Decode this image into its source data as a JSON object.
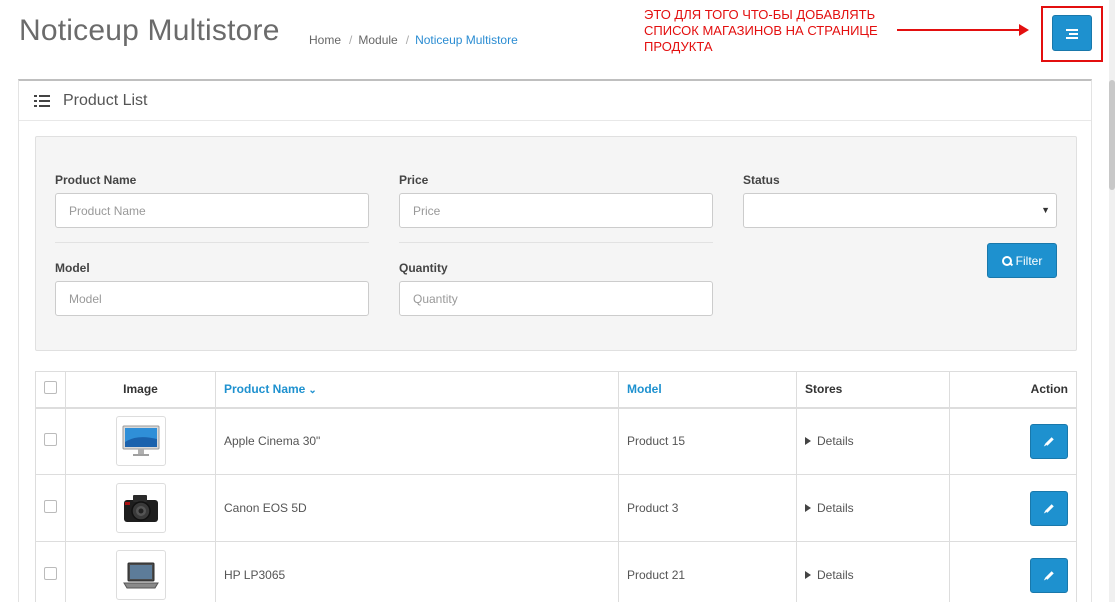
{
  "header": {
    "title": "Noticeup Multistore",
    "breadcrumb": [
      "Home",
      "Module",
      "Noticeup Multistore"
    ]
  },
  "annotation": {
    "text": "ЭТО ДЛЯ ТОГО ЧТО-БЫ ДОБАВЛЯТЬ СПИСОК МАГАЗИНОВ НА СТРАНИЦЕ ПРОДУКТА",
    "color": "#e30f0f"
  },
  "panel": {
    "title": "Product List",
    "icon": "list-icon"
  },
  "filter": {
    "product_name_label": "Product Name",
    "product_name_placeholder": "Product Name",
    "price_label": "Price",
    "price_placeholder": "Price",
    "status_label": "Status",
    "status_value": "",
    "model_label": "Model",
    "model_placeholder": "Model",
    "quantity_label": "Quantity",
    "quantity_placeholder": "Quantity",
    "button_label": "Filter"
  },
  "table": {
    "headers": [
      "Image",
      "Product Name",
      "Model",
      "Stores",
      "Action"
    ],
    "rows": [
      {
        "name": "Apple Cinema 30\"",
        "model": "Product 15",
        "stores": "Details",
        "image": "monitor"
      },
      {
        "name": "Canon EOS 5D",
        "model": "Product 3",
        "stores": "Details",
        "image": "camera"
      },
      {
        "name": "HP LP3065",
        "model": "Product 21",
        "stores": "Details",
        "image": "laptop"
      }
    ]
  },
  "colors": {
    "accent": "#1e91cf",
    "annotation": "#e30f0f"
  }
}
